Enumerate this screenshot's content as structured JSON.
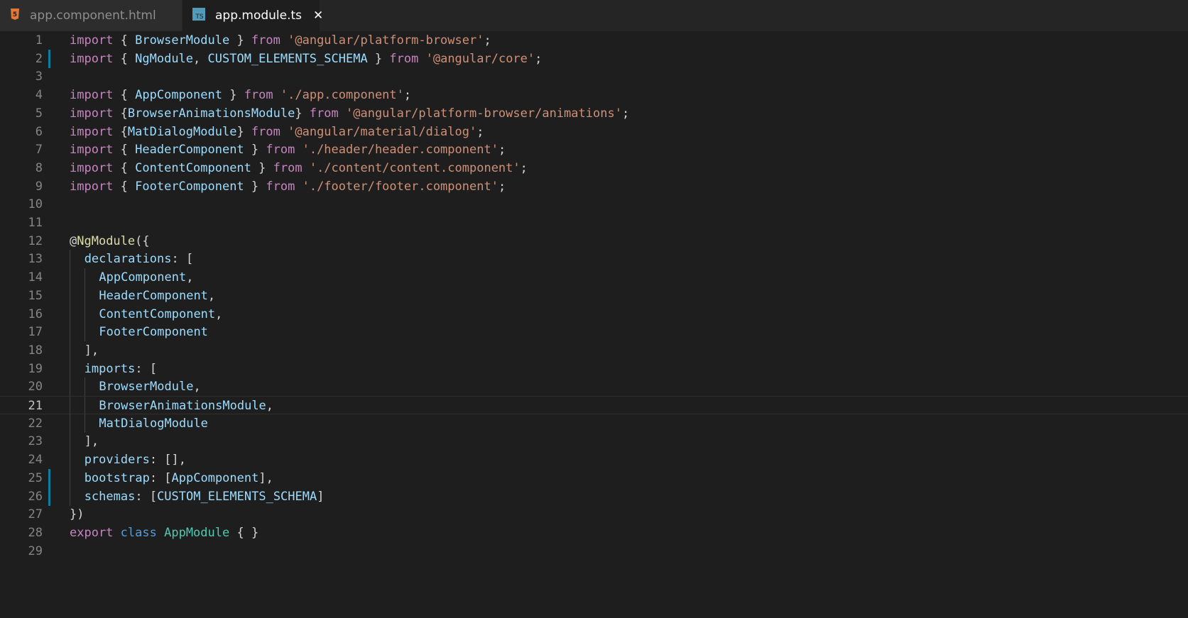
{
  "tabs": [
    {
      "label": "app.component.html",
      "icon": "html5-file-icon",
      "active": false
    },
    {
      "label": "app.module.ts",
      "icon": "typescript-file-icon",
      "active": true,
      "close_glyph": "✕"
    }
  ],
  "icon_text": {
    "html": "5",
    "ts": "TS"
  },
  "colors": {
    "background": "#1e1e1e",
    "keyword_control": "#c586c0",
    "keyword": "#569cd6",
    "string": "#ce9178",
    "variable": "#9cdcfe",
    "class": "#4ec9b0",
    "decorator": "#dcdcaa",
    "line_number": "#858585",
    "modified_gutter": "#0c7d9d"
  },
  "editor": {
    "current_line": 21,
    "modified_lines": [
      2,
      25,
      26
    ],
    "lines": [
      {
        "number": "1",
        "indent": 0,
        "tokens": [
          [
            "import",
            "kw-ctrl"
          ],
          [
            " { ",
            "pun"
          ],
          [
            "BrowserModule",
            "var"
          ],
          [
            " } ",
            "pun"
          ],
          [
            "from",
            "kw-ctrl"
          ],
          [
            " ",
            "pun"
          ],
          [
            "'@angular/platform-browser'",
            "str"
          ],
          [
            ";",
            "pun"
          ]
        ]
      },
      {
        "number": "2",
        "indent": 0,
        "tokens": [
          [
            "import",
            "kw-ctrl"
          ],
          [
            " { ",
            "pun"
          ],
          [
            "NgModule",
            "var"
          ],
          [
            ", ",
            "pun"
          ],
          [
            "CUSTOM_ELEMENTS_SCHEMA",
            "var"
          ],
          [
            " } ",
            "pun"
          ],
          [
            "from",
            "kw-ctrl"
          ],
          [
            " ",
            "pun"
          ],
          [
            "'@angular/core'",
            "str"
          ],
          [
            ";",
            "pun"
          ]
        ]
      },
      {
        "number": "3",
        "indent": 0,
        "tokens": []
      },
      {
        "number": "4",
        "indent": 0,
        "tokens": [
          [
            "import",
            "kw-ctrl"
          ],
          [
            " { ",
            "pun"
          ],
          [
            "AppComponent",
            "var"
          ],
          [
            " } ",
            "pun"
          ],
          [
            "from",
            "kw-ctrl"
          ],
          [
            " ",
            "pun"
          ],
          [
            "'./app.component'",
            "str"
          ],
          [
            ";",
            "pun"
          ]
        ]
      },
      {
        "number": "5",
        "indent": 0,
        "tokens": [
          [
            "import",
            "kw-ctrl"
          ],
          [
            " {",
            "pun"
          ],
          [
            "BrowserAnimationsModule",
            "var"
          ],
          [
            "} ",
            "pun"
          ],
          [
            "from",
            "kw-ctrl"
          ],
          [
            " ",
            "pun"
          ],
          [
            "'@angular/platform-browser/animations'",
            "str"
          ],
          [
            ";",
            "pun"
          ]
        ]
      },
      {
        "number": "6",
        "indent": 0,
        "tokens": [
          [
            "import",
            "kw-ctrl"
          ],
          [
            " {",
            "pun"
          ],
          [
            "MatDialogModule",
            "var"
          ],
          [
            "} ",
            "pun"
          ],
          [
            "from",
            "kw-ctrl"
          ],
          [
            " ",
            "pun"
          ],
          [
            "'@angular/material/dialog'",
            "str"
          ],
          [
            ";",
            "pun"
          ]
        ]
      },
      {
        "number": "7",
        "indent": 0,
        "tokens": [
          [
            "import",
            "kw-ctrl"
          ],
          [
            " { ",
            "pun"
          ],
          [
            "HeaderComponent",
            "var"
          ],
          [
            " } ",
            "pun"
          ],
          [
            "from",
            "kw-ctrl"
          ],
          [
            " ",
            "pun"
          ],
          [
            "'./header/header.component'",
            "str"
          ],
          [
            ";",
            "pun"
          ]
        ]
      },
      {
        "number": "8",
        "indent": 0,
        "tokens": [
          [
            "import",
            "kw-ctrl"
          ],
          [
            " { ",
            "pun"
          ],
          [
            "ContentComponent",
            "var"
          ],
          [
            " } ",
            "pun"
          ],
          [
            "from",
            "kw-ctrl"
          ],
          [
            " ",
            "pun"
          ],
          [
            "'./content/content.component'",
            "str"
          ],
          [
            ";",
            "pun"
          ]
        ]
      },
      {
        "number": "9",
        "indent": 0,
        "tokens": [
          [
            "import",
            "kw-ctrl"
          ],
          [
            " { ",
            "pun"
          ],
          [
            "FooterComponent",
            "var"
          ],
          [
            " } ",
            "pun"
          ],
          [
            "from",
            "kw-ctrl"
          ],
          [
            " ",
            "pun"
          ],
          [
            "'./footer/footer.component'",
            "str"
          ],
          [
            ";",
            "pun"
          ]
        ]
      },
      {
        "number": "10",
        "indent": 0,
        "tokens": []
      },
      {
        "number": "11",
        "indent": 0,
        "tokens": []
      },
      {
        "number": "12",
        "indent": 0,
        "tokens": [
          [
            "@",
            "pun"
          ],
          [
            "NgModule",
            "dec"
          ],
          [
            "({",
            "pun"
          ]
        ]
      },
      {
        "number": "13",
        "indent": 1,
        "tokens": [
          [
            "declarations",
            "var"
          ],
          [
            ": [",
            "pun"
          ]
        ]
      },
      {
        "number": "14",
        "indent": 2,
        "tokens": [
          [
            "AppComponent",
            "var"
          ],
          [
            ",",
            "pun"
          ]
        ]
      },
      {
        "number": "15",
        "indent": 2,
        "tokens": [
          [
            "HeaderComponent",
            "var"
          ],
          [
            ",",
            "pun"
          ]
        ]
      },
      {
        "number": "16",
        "indent": 2,
        "tokens": [
          [
            "ContentComponent",
            "var"
          ],
          [
            ",",
            "pun"
          ]
        ]
      },
      {
        "number": "17",
        "indent": 2,
        "tokens": [
          [
            "FooterComponent",
            "var"
          ]
        ]
      },
      {
        "number": "18",
        "indent": 1,
        "tokens": [
          [
            "],",
            "pun"
          ]
        ]
      },
      {
        "number": "19",
        "indent": 1,
        "tokens": [
          [
            "imports",
            "var"
          ],
          [
            ": [",
            "pun"
          ]
        ]
      },
      {
        "number": "20",
        "indent": 2,
        "tokens": [
          [
            "BrowserModule",
            "var"
          ],
          [
            ",",
            "pun"
          ]
        ]
      },
      {
        "number": "21",
        "indent": 2,
        "tokens": [
          [
            "BrowserAnimationsModule",
            "var"
          ],
          [
            ",",
            "pun"
          ]
        ]
      },
      {
        "number": "22",
        "indent": 2,
        "tokens": [
          [
            "MatDialogModule",
            "var"
          ]
        ]
      },
      {
        "number": "23",
        "indent": 1,
        "tokens": [
          [
            "],",
            "pun"
          ]
        ]
      },
      {
        "number": "24",
        "indent": 1,
        "tokens": [
          [
            "providers",
            "var"
          ],
          [
            ": [],",
            "pun"
          ]
        ]
      },
      {
        "number": "25",
        "indent": 1,
        "tokens": [
          [
            "bootstrap",
            "var"
          ],
          [
            ": [",
            "pun"
          ],
          [
            "AppComponent",
            "var"
          ],
          [
            "],",
            "pun"
          ]
        ]
      },
      {
        "number": "26",
        "indent": 1,
        "tokens": [
          [
            "schemas",
            "var"
          ],
          [
            ": [",
            "pun"
          ],
          [
            "CUSTOM_ELEMENTS_SCHEMA",
            "var"
          ],
          [
            "]",
            "pun"
          ]
        ]
      },
      {
        "number": "27",
        "indent": 0,
        "tokens": [
          [
            "})",
            "pun"
          ]
        ]
      },
      {
        "number": "28",
        "indent": 0,
        "tokens": [
          [
            "export",
            "kw-ctrl"
          ],
          [
            " ",
            "pun"
          ],
          [
            "class",
            "kw"
          ],
          [
            " ",
            "pun"
          ],
          [
            "AppModule",
            "cls"
          ],
          [
            " { }",
            "pun"
          ]
        ]
      },
      {
        "number": "29",
        "indent": 0,
        "tokens": []
      }
    ]
  }
}
